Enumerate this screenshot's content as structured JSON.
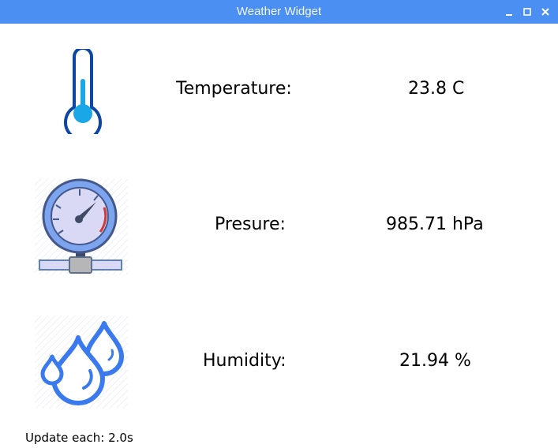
{
  "window": {
    "title": "Weather Widget"
  },
  "rows": [
    {
      "label": "Temperature:",
      "value": "23.8 C",
      "icon": "thermometer-icon"
    },
    {
      "label": "Presure:",
      "value": "985.71 hPa",
      "icon": "pressure-gauge-icon"
    },
    {
      "label": "Humidity:",
      "value": "21.94 %",
      "icon": "water-drops-icon"
    }
  ],
  "footer": {
    "update_text": "Update each: 2.0s"
  },
  "colors": {
    "titlebar": "#4b8ff2",
    "accent": "#1a8fe0",
    "drops": "#3a79ee"
  }
}
